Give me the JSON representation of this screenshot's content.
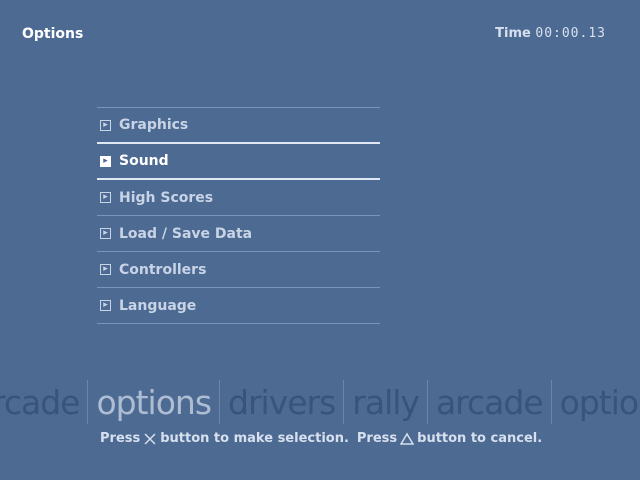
{
  "header": {
    "title": "Options",
    "time_label": "Time",
    "time_value": "00:00.13"
  },
  "menu": {
    "items": [
      {
        "label": "Graphics",
        "selected": false
      },
      {
        "label": "Sound",
        "selected": true
      },
      {
        "label": "High Scores",
        "selected": false
      },
      {
        "label": "Load / Save Data",
        "selected": false
      },
      {
        "label": "Controllers",
        "selected": false
      },
      {
        "label": "Language",
        "selected": false
      }
    ]
  },
  "nav_strip": {
    "words": [
      "rcade",
      "options",
      "drivers",
      "rally",
      "arcade",
      "option"
    ],
    "current_index": 1
  },
  "hint": {
    "part1": "Press",
    "part2": "button to make selection.",
    "part3": "Press",
    "part4": "button to cancel.",
    "confirm_icon": "cross-icon",
    "cancel_icon": "triangle-icon"
  },
  "colors": {
    "background": "#4d6a93",
    "nav_word": "#38547c",
    "nav_word_current": "#aebdd3"
  }
}
